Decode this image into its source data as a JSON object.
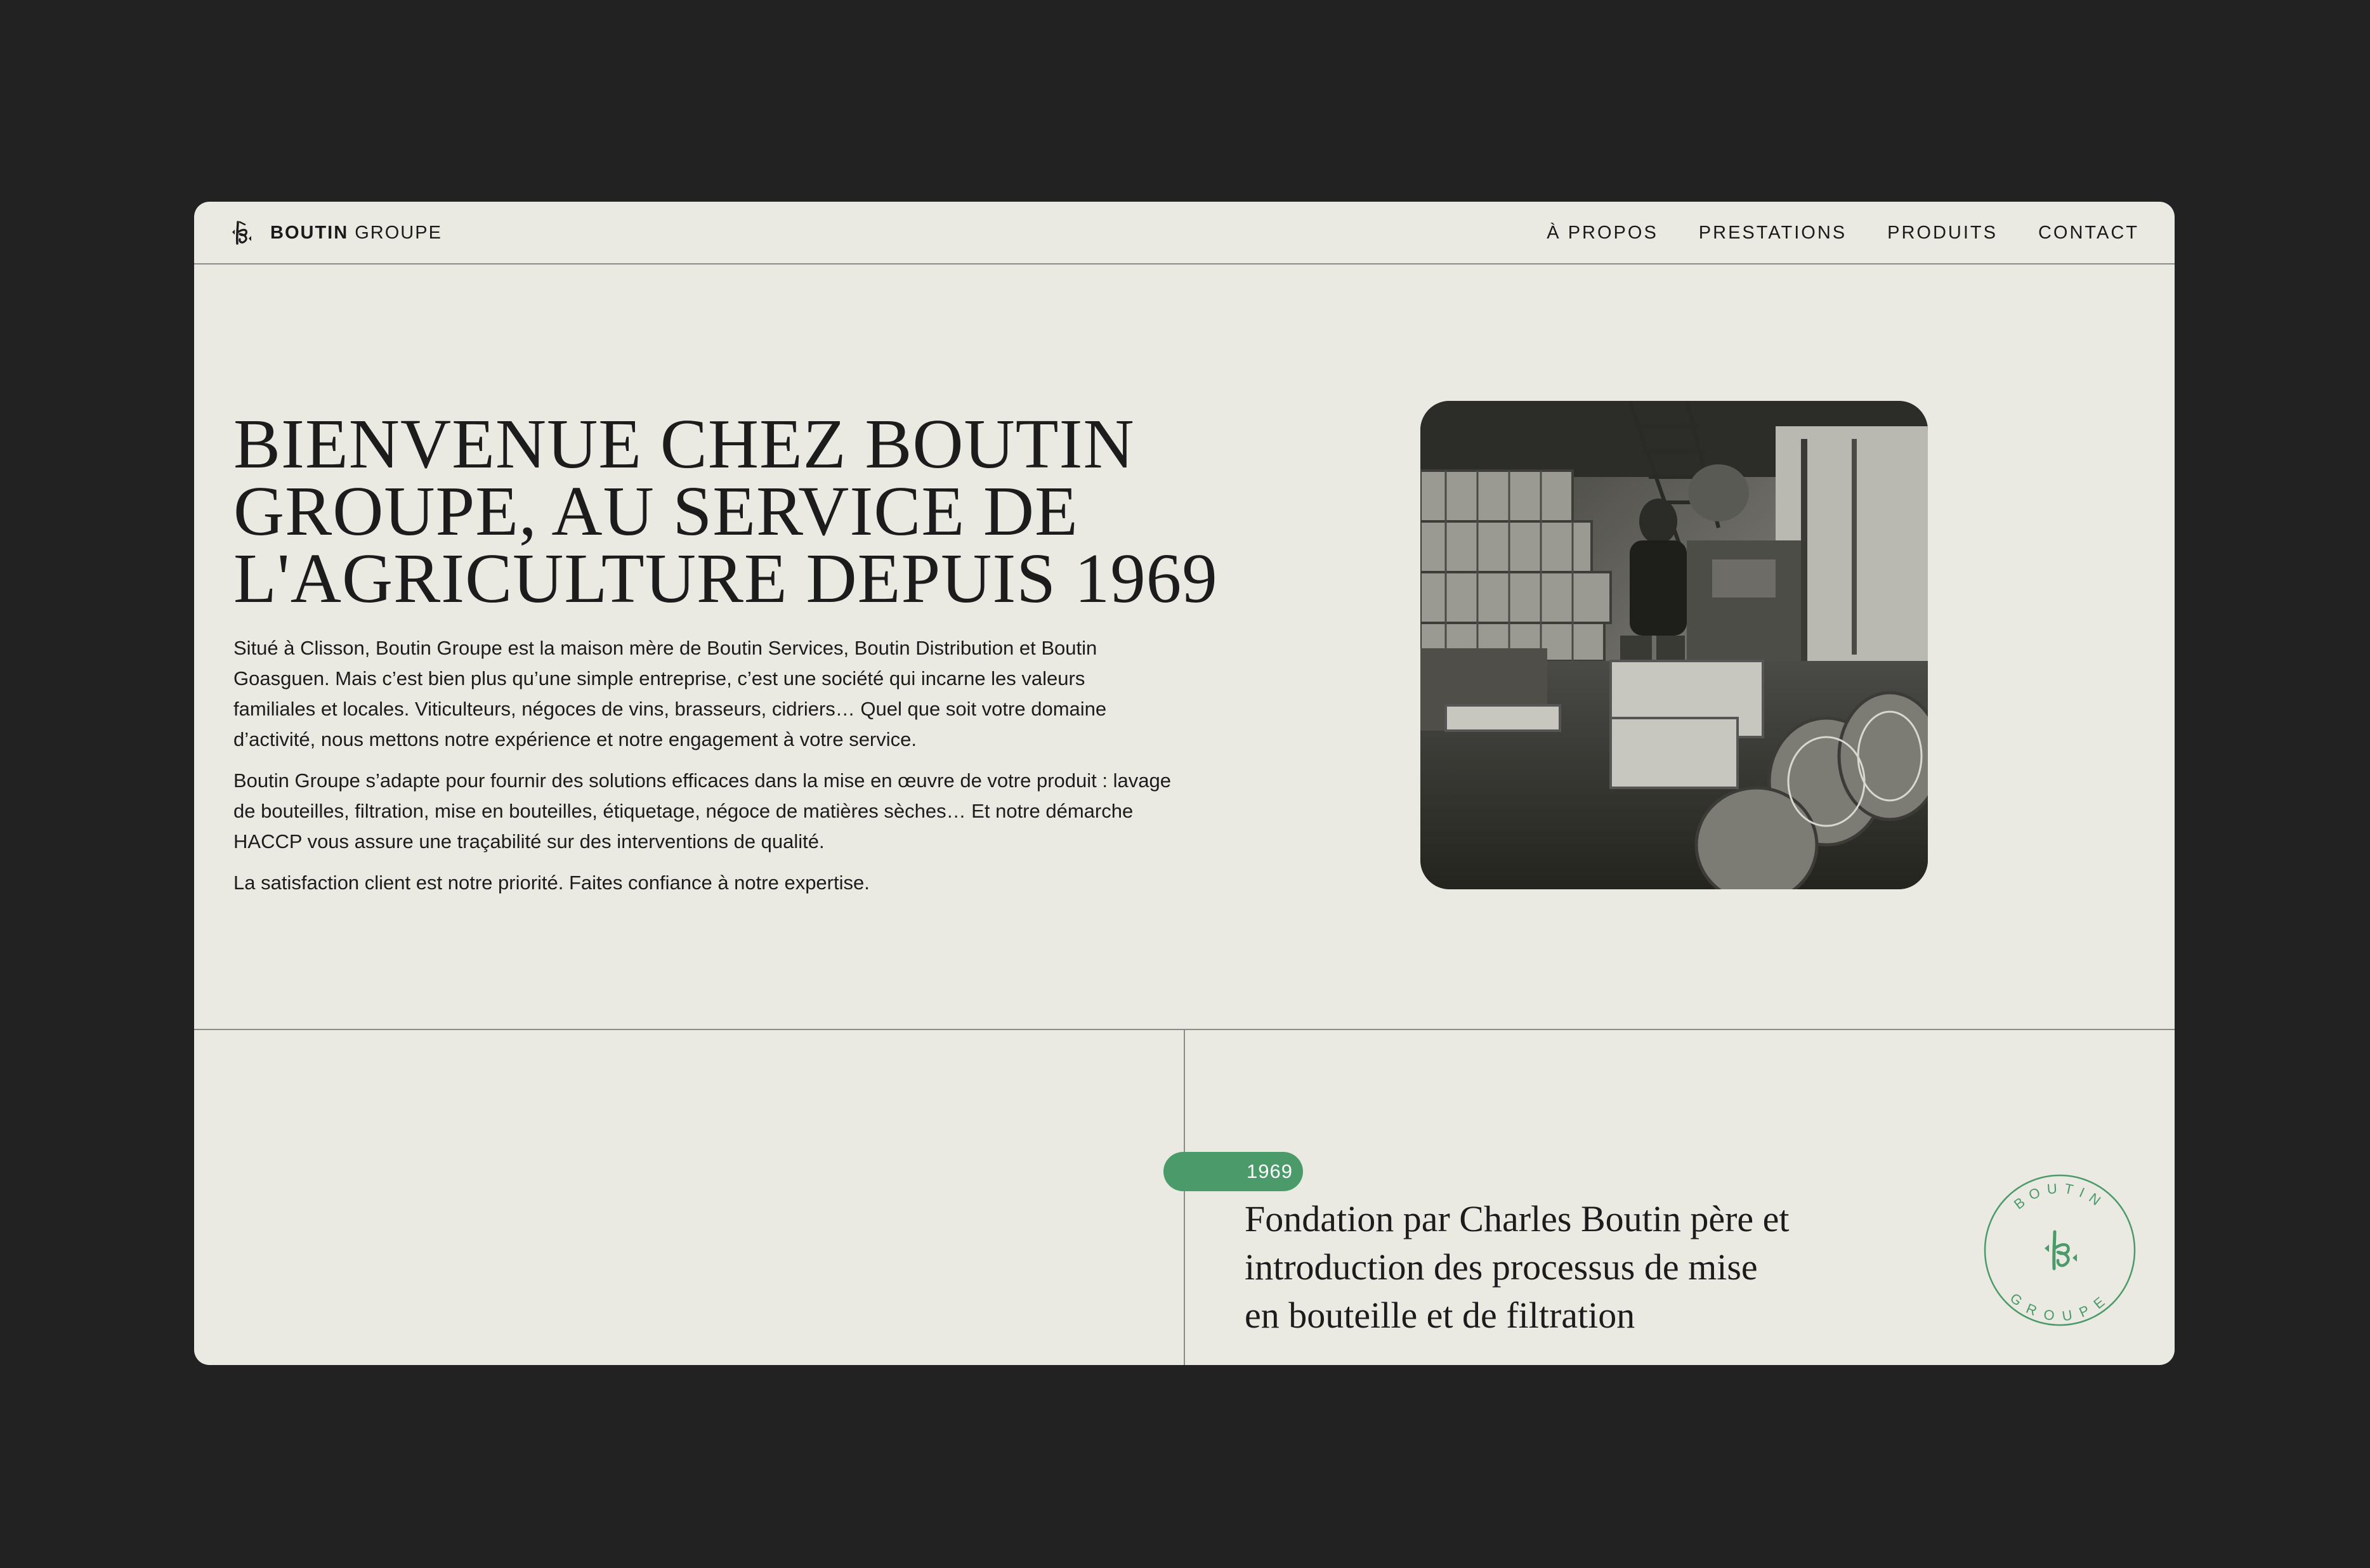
{
  "header": {
    "brand_bold": "BOUTIN",
    "brand_light": "GROUPE",
    "nav": [
      {
        "label": "À PROPOS"
      },
      {
        "label": "PRESTATIONS"
      },
      {
        "label": "PRODUITS"
      },
      {
        "label": "CONTACT"
      }
    ]
  },
  "hero": {
    "title_lines": [
      "BIENVENUE CHEZ BOUTIN",
      "GROUPE, AU SERVICE DE",
      "L'AGRICULTURE DEPUIS 1969"
    ],
    "paragraphs": [
      "Situé à Clisson, Boutin Groupe est la maison mère de Boutin Services, Boutin Distribution et Boutin Goasguen. Mais c’est bien plus qu’une simple entreprise, c’est une société qui incarne les valeurs familiales et locales. Viticulteurs, négoces de vins, brasseurs, cidriers… Quel que soit votre domaine d’activité, nous mettons notre expérience et notre engagement à votre service.",
      "Boutin Groupe s’adapte pour fournir des solutions efficaces dans la mise en œuvre de votre produit : lavage de bouteilles, filtration, mise en bouteilles, étiquetage, négoce de matières sèches… Et notre démarche HACCP vous assure une traçabilité sur des interventions de qualité.",
      "La satisfaction client est notre priorité. Faites confiance à notre expertise."
    ]
  },
  "timeline": {
    "year": "1969",
    "event": "Fondation par Charles Boutin père et introduction des processus de mise en bouteille et de filtration"
  },
  "seal": {
    "top_text": "BOUTIN",
    "bottom_text": "GROUPE"
  },
  "colors": {
    "background": "#222222",
    "page": "#eae9e2",
    "accent": "#4a9a6a",
    "text": "#1c1c1c"
  },
  "icons": {
    "brand": "boutin-monogram-icon",
    "photo": "vintage-bottling-photo"
  }
}
